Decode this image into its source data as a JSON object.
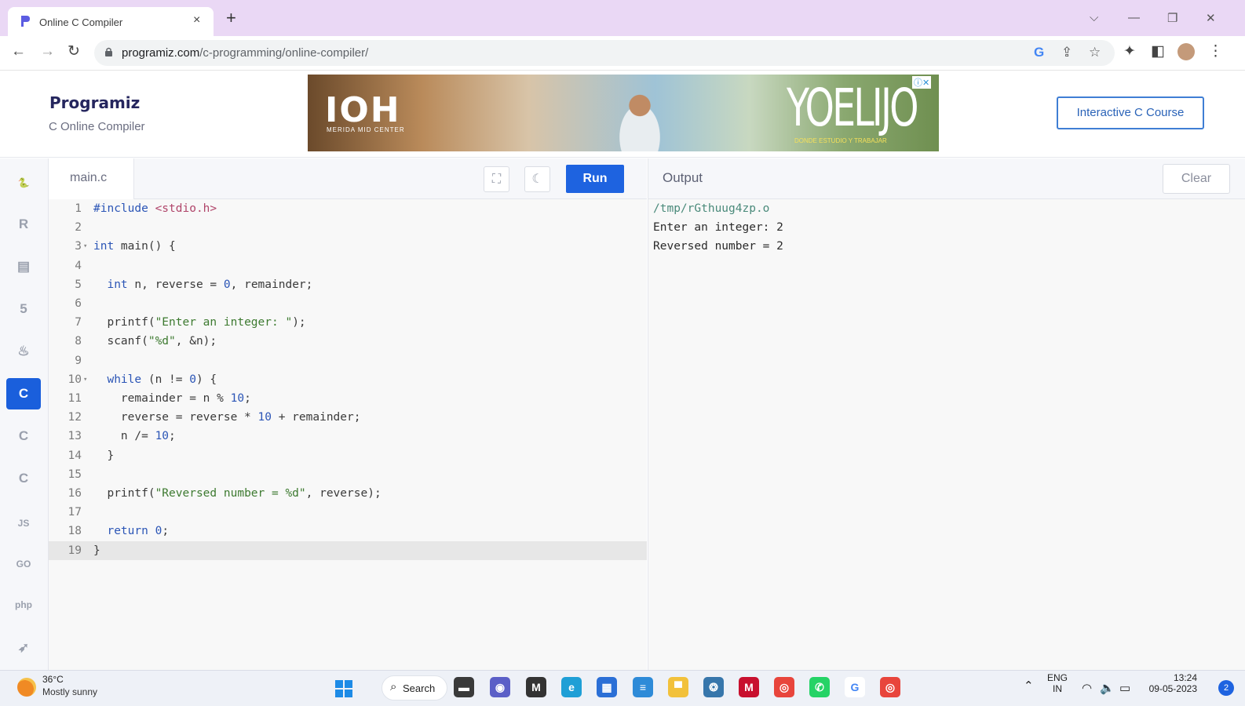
{
  "browser": {
    "tab_title": "Online C Compiler",
    "url_domain": "programiz.com",
    "url_path": "/c-programming/online-compiler/",
    "new_tab": "+",
    "close_tab": "×"
  },
  "site": {
    "logo": "Programiz",
    "subtitle": "C Online Compiler",
    "cta": "Interactive C Course",
    "ad": {
      "brand": "IOH",
      "brand_sub": "MERIDA MID CENTER",
      "slogan": "YOELIJO",
      "slogan_sub": "DONDE ESTUDIO Y TRABAJAR"
    }
  },
  "rail": {
    "items": [
      {
        "name": "python",
        "glyph": "🐍",
        "icon": "python-icon"
      },
      {
        "name": "r",
        "glyph": "R",
        "icon": "r-icon"
      },
      {
        "name": "sql",
        "glyph": "▤",
        "icon": "sql-database-icon"
      },
      {
        "name": "html",
        "glyph": "5",
        "icon": "html5-icon"
      },
      {
        "name": "java",
        "glyph": "♨",
        "icon": "java-icon"
      },
      {
        "name": "c",
        "glyph": "C",
        "icon": "c-icon",
        "active": true
      },
      {
        "name": "cpp",
        "glyph": "C",
        "icon": "cpp-icon"
      },
      {
        "name": "csharp",
        "glyph": "C",
        "icon": "csharp-icon"
      },
      {
        "name": "js",
        "glyph": "JS",
        "icon": "javascript-icon"
      },
      {
        "name": "go",
        "glyph": "GO",
        "icon": "go-icon"
      },
      {
        "name": "php",
        "glyph": "php",
        "icon": "php-icon"
      },
      {
        "name": "swift",
        "glyph": "➶",
        "icon": "swift-icon"
      }
    ]
  },
  "editor": {
    "file_name": "main.c",
    "run_label": "Run",
    "current_line": 19,
    "lines": [
      {
        "n": "1",
        "fold": false,
        "html": "<span style=\"color:#2b55b6\">#include</span> <span style=\"color:#b0456a\">&lt;stdio.h&gt;</span>"
      },
      {
        "n": "2",
        "fold": false,
        "html": ""
      },
      {
        "n": "3",
        "fold": true,
        "html": "<span style=\"color:#2b55b6\">int</span> main() {"
      },
      {
        "n": "4",
        "fold": false,
        "html": ""
      },
      {
        "n": "5",
        "fold": false,
        "html": "  <span style=\"color:#2b55b6\">int</span> n, reverse = <span style=\"color:#2b55b6\">0</span>, remainder;"
      },
      {
        "n": "6",
        "fold": false,
        "html": ""
      },
      {
        "n": "7",
        "fold": false,
        "html": "  printf(<span style=\"color:#3d7a30\">\"Enter an integer: \"</span>);"
      },
      {
        "n": "8",
        "fold": false,
        "html": "  scanf(<span style=\"color:#3d7a30\">\"%d\"</span>, &amp;n);"
      },
      {
        "n": "9",
        "fold": false,
        "html": ""
      },
      {
        "n": "10",
        "fold": true,
        "html": "  <span style=\"color:#2b55b6\">while</span> (n != <span style=\"color:#2b55b6\">0</span>) {"
      },
      {
        "n": "11",
        "fold": false,
        "html": "    remainder = n % <span style=\"color:#2b55b6\">10</span>;"
      },
      {
        "n": "12",
        "fold": false,
        "html": "    reverse = reverse * <span style=\"color:#2b55b6\">10</span> + remainder;"
      },
      {
        "n": "13",
        "fold": false,
        "html": "    n /= <span style=\"color:#2b55b6\">10</span>;"
      },
      {
        "n": "14",
        "fold": false,
        "html": "  }"
      },
      {
        "n": "15",
        "fold": false,
        "html": ""
      },
      {
        "n": "16",
        "fold": false,
        "html": "  printf(<span style=\"color:#3d7a30\">\"Reversed number = %d\"</span>, reverse);"
      },
      {
        "n": "17",
        "fold": false,
        "html": ""
      },
      {
        "n": "18",
        "fold": false,
        "html": "  <span style=\"color:#2b55b6\">return</span> <span style=\"color:#2b55b6\">0</span>;"
      },
      {
        "n": "19",
        "fold": false,
        "html": "}"
      }
    ]
  },
  "output": {
    "title": "Output",
    "clear_label": "Clear",
    "lines": [
      "/tmp/rGthuug4zp.o",
      "Enter an integer: 2",
      "Reversed number = 2"
    ]
  },
  "taskbar": {
    "temperature": "36°C",
    "weather": "Mostly sunny",
    "search_label": "Search",
    "lang_top": "ENG",
    "lang_bottom": "IN",
    "time": "13:24",
    "date": "09-05-2023",
    "notifications": "2",
    "apps": [
      {
        "name": "file-explorer-icon",
        "bg": "#3a3a3a",
        "glyph": "▬"
      },
      {
        "name": "teams-chat-icon",
        "bg": "#5b5fc7",
        "glyph": "◉"
      },
      {
        "name": "m-app-icon",
        "bg": "#333333",
        "glyph": "M"
      },
      {
        "name": "edge-icon",
        "bg": "#1f9fd6",
        "glyph": "e"
      },
      {
        "name": "store-icon",
        "bg": "#2b6fd6",
        "glyph": "▦"
      },
      {
        "name": "app-icon",
        "bg": "#2e8bd8",
        "glyph": "≡"
      },
      {
        "name": "folder-icon",
        "bg": "#f2c13b",
        "glyph": "▀"
      },
      {
        "name": "python-app-icon",
        "bg": "#3776ab",
        "glyph": "❂"
      },
      {
        "name": "mcafee-icon",
        "bg": "#c8102e",
        "glyph": "M"
      },
      {
        "name": "chrome-icon",
        "bg": "#e8453c",
        "glyph": "◎"
      },
      {
        "name": "whatsapp-icon",
        "bg": "#25d366",
        "glyph": "✆"
      },
      {
        "name": "google-icon",
        "bg": "#ffffff",
        "glyph": "G"
      },
      {
        "name": "chrome-profile-icon",
        "bg": "#e8453c",
        "glyph": "◎"
      }
    ]
  }
}
